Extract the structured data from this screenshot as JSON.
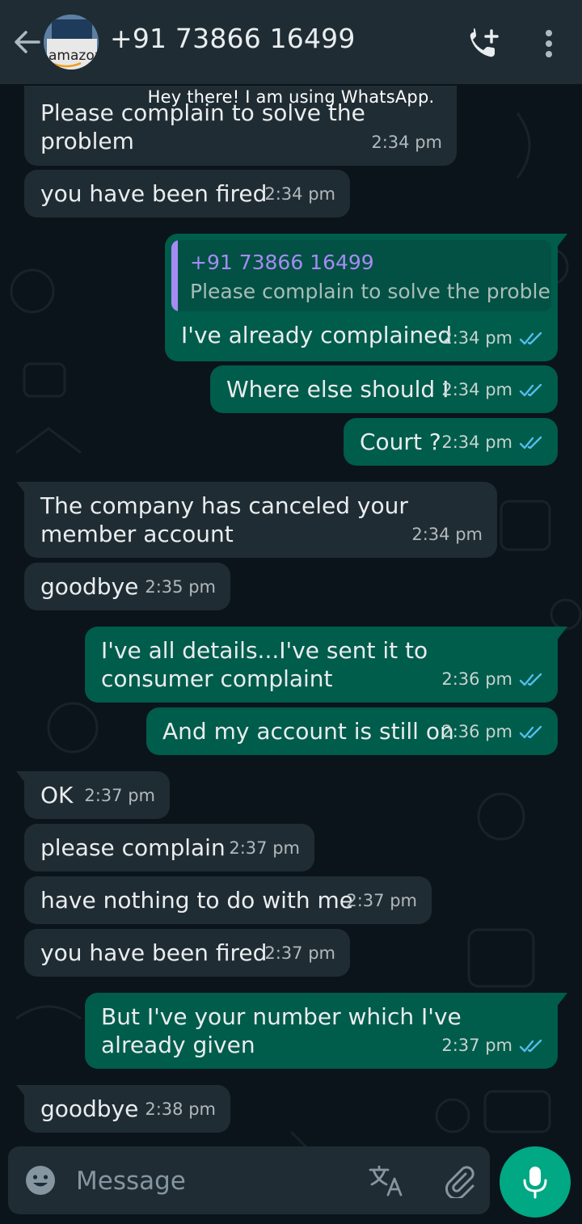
{
  "header": {
    "contact_name": "+91 73866 16499",
    "status": "Hey there! I am using WhatsApp.",
    "avatar_text": "amazon"
  },
  "messages": [
    {
      "dir": "in",
      "text": "Please complain to solve the problem",
      "time": "2:34 pm"
    },
    {
      "dir": "in",
      "text": "you have been fired",
      "time": "2:34 pm"
    },
    {
      "dir": "out",
      "text": "I've already complained",
      "time": "2:34 pm",
      "quote": {
        "author": "+91 73866 16499",
        "text": "Please complain to solve the problem"
      }
    },
    {
      "dir": "out",
      "text": "Where else should I",
      "time": "2:34 pm"
    },
    {
      "dir": "out",
      "text": "Court ?",
      "time": "2:34 pm"
    },
    {
      "dir": "in",
      "text": "The company has canceled your member account",
      "time": "2:34 pm"
    },
    {
      "dir": "in",
      "text": "goodbye",
      "time": "2:35 pm"
    },
    {
      "dir": "out",
      "text": "I've all details...I've sent it to consumer complaint",
      "time": "2:36 pm"
    },
    {
      "dir": "out",
      "text": "And my account is still on",
      "time": "2:36 pm"
    },
    {
      "dir": "in",
      "text": "OK",
      "time": "2:37 pm"
    },
    {
      "dir": "in",
      "text": "please complain",
      "time": "2:37 pm"
    },
    {
      "dir": "in",
      "text": "have nothing to do with me",
      "time": "2:37 pm"
    },
    {
      "dir": "in",
      "text": "you have been fired",
      "time": "2:37 pm"
    },
    {
      "dir": "out",
      "text": "But I've your number which I've already given",
      "time": "2:37 pm"
    },
    {
      "dir": "in",
      "text": "goodbye",
      "time": "2:38 pm"
    }
  ],
  "composer": {
    "placeholder": "Message"
  },
  "icons": {
    "back": "arrow-left-icon",
    "call": "add-call-icon",
    "menu": "more-vertical-icon",
    "emoji": "emoji-icon",
    "translate": "translate-icon",
    "attach": "paperclip-icon",
    "mic": "microphone-icon",
    "read": "double-check-icon"
  },
  "colors": {
    "background": "#0b141a",
    "header": "#1f2c34",
    "incoming": "#202c33",
    "outgoing": "#005c4b",
    "accent": "#00a884",
    "read_ticks": "#53bdeb",
    "quote_author": "#a78bf5"
  }
}
